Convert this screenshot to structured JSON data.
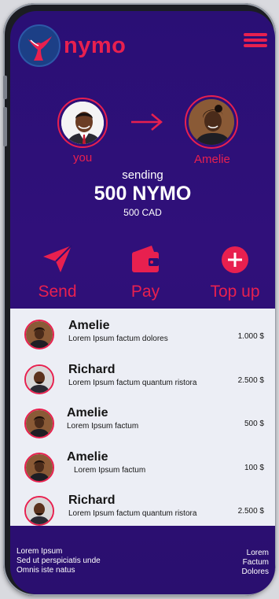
{
  "app": {
    "brand": "nymo",
    "accent": "#e8204f",
    "bg": "#2a0f75"
  },
  "header": {
    "logo_icon": "whale-tail-icon",
    "menu_icon": "hamburger-menu-icon"
  },
  "transfer": {
    "from_label": "you",
    "to_label": "Amelie",
    "status": "sending",
    "amount": "500 NYMO",
    "amount_fiat": "500 CAD",
    "arrow_icon": "arrow-right-icon"
  },
  "actions": [
    {
      "label": "Send",
      "icon": "paper-plane-icon"
    },
    {
      "label": "Pay",
      "icon": "wallet-icon"
    },
    {
      "label": "Top up",
      "icon": "plus-circle-icon"
    }
  ],
  "transactions": [
    {
      "name": "Amelie",
      "desc": "Lorem Ipsum factum  dolores",
      "amount": "1.000 $"
    },
    {
      "name": "Richard",
      "desc": "Lorem Ipsum factum quantum ristora",
      "amount": "2.500 $"
    },
    {
      "name": "Amelie",
      "desc": "Lorem Ipsum factum",
      "amount": "500 $"
    },
    {
      "name": "Amelie",
      "desc": "Lorem Ipsum factum",
      "amount": "100 $"
    },
    {
      "name": "Richard",
      "desc": "Lorem Ipsum factum quantum ristora",
      "amount": "2.500 $"
    }
  ],
  "footer": {
    "left": [
      "Lorem Ipsum",
      "Sed ut perspiciatis unde",
      "Omnis iste natus"
    ],
    "right": [
      "Lorem",
      "Factum",
      "Dolores"
    ]
  }
}
